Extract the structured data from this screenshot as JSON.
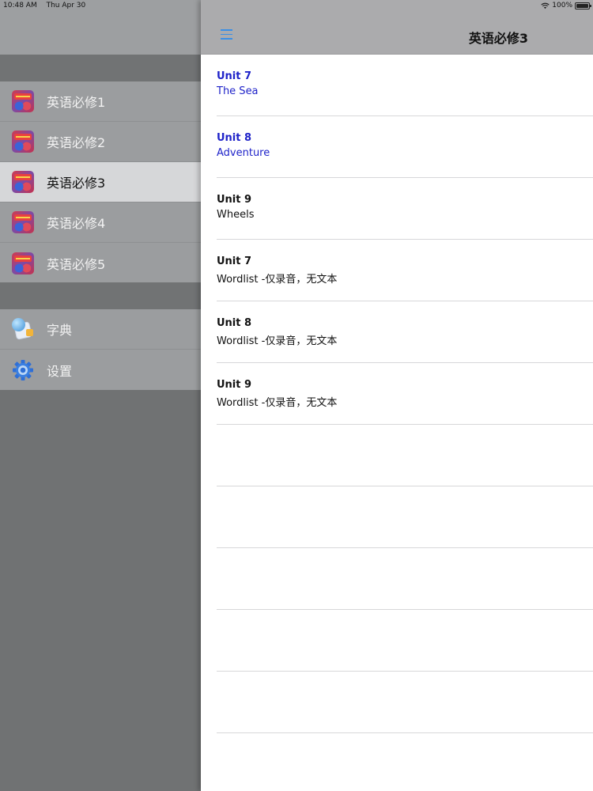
{
  "status_bar": {
    "time": "10:48 AM",
    "date": "Thu Apr 30",
    "battery": "100%"
  },
  "sidebar": {
    "books": [
      {
        "label": "英语必修1",
        "selected": false
      },
      {
        "label": "英语必修2",
        "selected": false
      },
      {
        "label": "英语必修3",
        "selected": true
      },
      {
        "label": "英语必修4",
        "selected": false
      },
      {
        "label": "英语必修5",
        "selected": false
      }
    ],
    "tools": [
      {
        "label": "字典",
        "icon": "dictionary-icon"
      },
      {
        "label": "设置",
        "icon": "gear-icon"
      }
    ]
  },
  "header": {
    "title": "英语必修3",
    "menu_icon": "hamburger-menu-icon"
  },
  "lessons": [
    {
      "title": "Unit 7",
      "subtitle": "The Sea",
      "highlighted": true
    },
    {
      "title": "Unit 8",
      "subtitle": "Adventure",
      "highlighted": true
    },
    {
      "title": "Unit 9",
      "subtitle": "Wheels",
      "highlighted": false
    },
    {
      "title": "Unit 7",
      "subtitle": "Wordlist -仅录音，无文本",
      "highlighted": false
    },
    {
      "title": "Unit 8",
      "subtitle": "Wordlist -仅录音，无文本",
      "highlighted": false
    },
    {
      "title": "Unit 9",
      "subtitle": "Wordlist -仅录音，无文本",
      "highlighted": false
    }
  ],
  "colors": {
    "accent": "#3a8fe6",
    "highlight_text": "#1f23c9",
    "selected_row": "#d6d7d9"
  }
}
